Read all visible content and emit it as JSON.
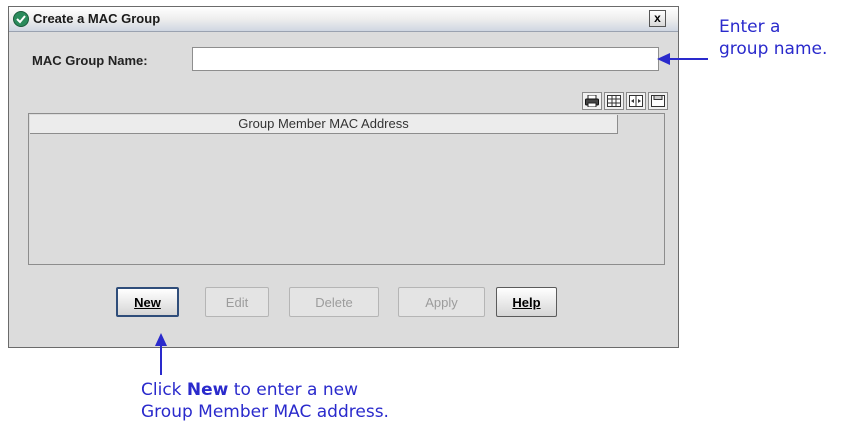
{
  "dialog": {
    "title": "Create a MAC Group",
    "close_label": "x"
  },
  "form": {
    "name_label": "MAC Group Name:",
    "name_value": "",
    "name_placeholder": ""
  },
  "table": {
    "toolbar_icons": [
      "print-icon",
      "table-view-icon",
      "columns-icon",
      "save-icon"
    ],
    "columns": [
      "Group Member MAC Address"
    ],
    "rows": []
  },
  "buttons": {
    "new": "New",
    "edit": "Edit",
    "delete": "Delete",
    "apply": "Apply",
    "help": "Help"
  },
  "annotations": {
    "name_note_line1": "Enter a",
    "name_note_line2": "group name.",
    "new_note_line1_pre": "Click ",
    "new_note_line1_bold": "New",
    "new_note_line1_post": " to enter a new",
    "new_note_line2": "Group Member MAC address.",
    "color": "#2a2acc"
  }
}
